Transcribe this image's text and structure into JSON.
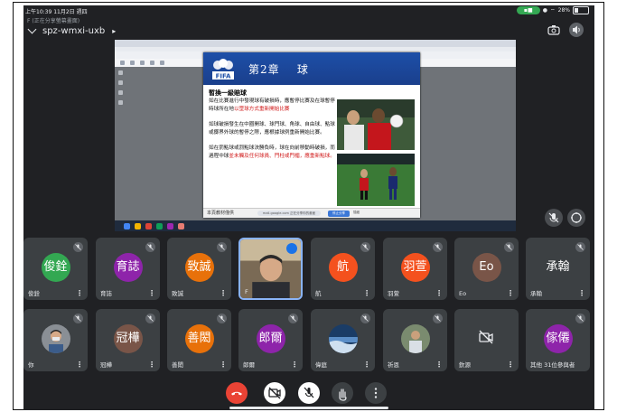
{
  "status_bar": {
    "time": "上午10:39",
    "date": "11月2日 週四",
    "battery": "28%"
  },
  "meeting": {
    "presenting_note": "F (正在分享螢幕畫面)",
    "code": "spz-wmxi-uxb"
  },
  "shared_slide": {
    "chapter": "第2章",
    "topic": "球",
    "logo_text": "FIFA",
    "section_title": "暫換一級賠球",
    "paragraphs": [
      {
        "normal": "如在比賽進行中發現球有破損時，應暫停比賽及在球暫停時球所在地",
        "red": "以墜球方式重新開始比賽"
      },
      {
        "normal": "如球破損發生在中圈開球、球門球、角球、自由球、點球或擲界外球的暫停之際，應根據球例重新開始比賽。",
        "red": ""
      },
      {
        "normal": "如在罰點球或罰點球決勝負時，球在向前移動時破損，而過程中球",
        "red": "並未觸及任何球員、門柱或門楣，應重新點球。"
      }
    ],
    "footer_left": "本頁教材僅供",
    "footer_url": "mail.google.com 正在分享你的畫面",
    "footer_button": "停止分享",
    "footer_hide": "隱藏"
  },
  "participants_row1": [
    {
      "initials": "俊銓",
      "label": "俊銓",
      "color": "#33a852"
    },
    {
      "initials": "育誌",
      "label": "育誌",
      "color": "#8e24aa"
    },
    {
      "initials": "致誠",
      "label": "致誠",
      "color": "#e8710a"
    },
    {
      "initials": "",
      "label": "F",
      "color": "#6b5b4a"
    },
    {
      "initials": "航",
      "label": "航",
      "color": "#f4511e"
    },
    {
      "initials": "羽萱",
      "label": "羽萱",
      "color": "#f4511e"
    },
    {
      "initials": "Eo",
      "label": "Eo",
      "color": "#795548"
    },
    {
      "initials": "承翰",
      "label": "承翰",
      "color": "#3c4043"
    }
  ],
  "participants_row2": [
    {
      "initials": "",
      "label": "你",
      "color": "#5f6368"
    },
    {
      "initials": "冠樺",
      "label": "冠樺",
      "color": "#795548"
    },
    {
      "initials": "善閎",
      "label": "善閎",
      "color": "#e8710a"
    },
    {
      "initials": "郎爾",
      "label": "郎爾",
      "color": "#8e24aa"
    },
    {
      "initials": "",
      "label": "偉庭",
      "color": "#1a3c66"
    },
    {
      "initials": "",
      "label": "祈恩",
      "color": "#7a8b6f"
    },
    {
      "initials": "",
      "label": "欽源",
      "color": "#3c4043"
    },
    {
      "initials": "傢僊",
      "label": "其他 31位參與者",
      "color": "#8e24aa"
    }
  ],
  "colors": {
    "bg": "#202124",
    "tile": "#3c4043",
    "hangup": "#ea4335",
    "fifa_blue": "#1d4fa8"
  }
}
